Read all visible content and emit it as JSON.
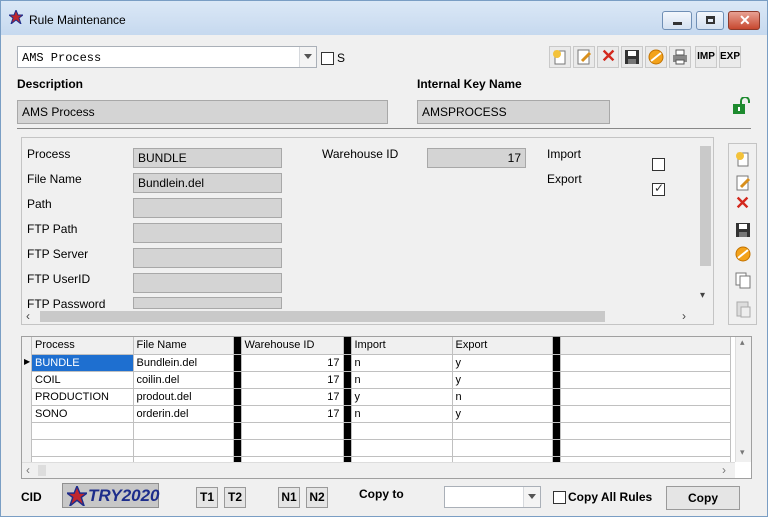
{
  "window": {
    "title": "Rule Maintenance"
  },
  "top": {
    "process_combo_value": "AMS Process",
    "s_label": "S",
    "toolbar": {
      "imp": "IMP",
      "exp": "EXP"
    }
  },
  "header": {
    "description_label": "Description",
    "description_value": "AMS Process",
    "key_label": "Internal Key Name",
    "key_value": "AMSPROCESS"
  },
  "form": {
    "process_label": "Process",
    "process_value": "BUNDLE",
    "file_label": "File Name",
    "file_value": "Bundlein.del",
    "path_label": "Path",
    "ftp_path_label": "FTP Path",
    "ftp_server_label": "FTP Server",
    "ftp_userid_label": "FTP UserID",
    "ftp_password_label": "FTP Password",
    "warehouse_label": "Warehouse ID",
    "warehouse_value": "17",
    "import_label": "Import",
    "export_label": "Export"
  },
  "grid": {
    "columns": [
      "Process",
      "File Name",
      "Warehouse ID",
      "Import",
      "Export"
    ],
    "rows": [
      [
        "BUNDLE",
        "Bundlein.del",
        "17",
        "n",
        "y"
      ],
      [
        "COIL",
        "coilin.del",
        "17",
        "n",
        "y"
      ],
      [
        "PRODUCTION",
        "prodout.del",
        "17",
        "y",
        "n"
      ],
      [
        "SONO",
        "orderin.del",
        "17",
        "n",
        "y"
      ]
    ]
  },
  "bottom": {
    "cid_label": "CID",
    "try_logo": "TRY2020",
    "t1": "T1",
    "t2": "T2",
    "n1": "N1",
    "n2": "N2",
    "copy_to_label": "Copy to",
    "copy_all_label": "Copy All Rules",
    "copy_button": "Copy"
  }
}
